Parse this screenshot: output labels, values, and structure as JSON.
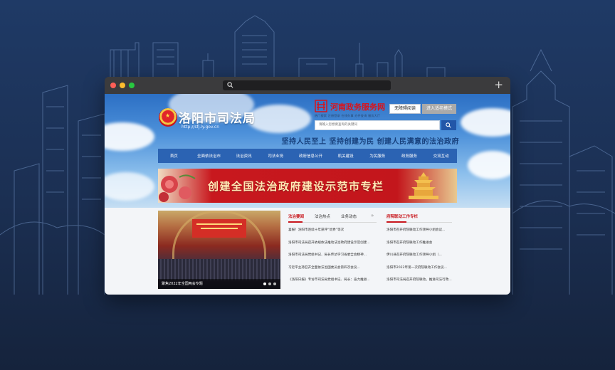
{
  "browser": {
    "address_value": "",
    "new_tab_icon": "plus-icon"
  },
  "site": {
    "title": "洛阳市司法局",
    "url": "http://sfj.ly.gov.cn",
    "gov_service_name": "河南政务服务网",
    "gov_service_sub": "热门搜索  注册登录  在线办事  办件查询  服务大厅",
    "accessible_btn": "无障碍阅读",
    "elder_btn": "进入适老模式",
    "search_placeholder": "请输入您想要查询的关键词",
    "slogan": "坚持人民至上 坚持创建为民 创建人民满意的法治政府"
  },
  "nav": [
    "首页",
    "全面依法治市",
    "法治资讯",
    "司法业务",
    "政府信息公开",
    "机关建设",
    "为民服务",
    "政务服务",
    "交流互动"
  ],
  "banner": {
    "text": "创建全国法治政府建设示范市专栏"
  },
  "feature_photo": {
    "caption": "聚焦2022年全国两会专题"
  },
  "news_tabs": [
    "法治要闻",
    "法治热点",
    "业务动态"
  ],
  "news_items": [
    "喜报！洛阳市连续十年获评“优秀”等次",
    "洛阳市司法局召开依规依法推动法治政府建设示范创建...",
    "洛阳市司法局党组书记、局长传达学习省委全会精神...",
    "习近平主持召开全面依法治国委员会第四次会议...",
    "《洛阳日报》专访市司法局党组书记、局长：奋力推进..."
  ],
  "col2": {
    "title": "府院联动工作专栏",
    "items": [
      "洛阳市召开府院联动工作领导小组会议...",
      "洛阳市召开府院联动工作推进会",
      "伊川县召开府院联动工作领导小组（...",
      "洛阳市2022年第一次府院联动工作会议...",
      "洛阳市司法局召开府院联动，推进司法行政..."
    ]
  },
  "colors": {
    "page_bg": "#1f3a66",
    "nav_blue": "#2b63b3",
    "accent_red": "#c8171d",
    "slogan_blue": "#17407c"
  }
}
